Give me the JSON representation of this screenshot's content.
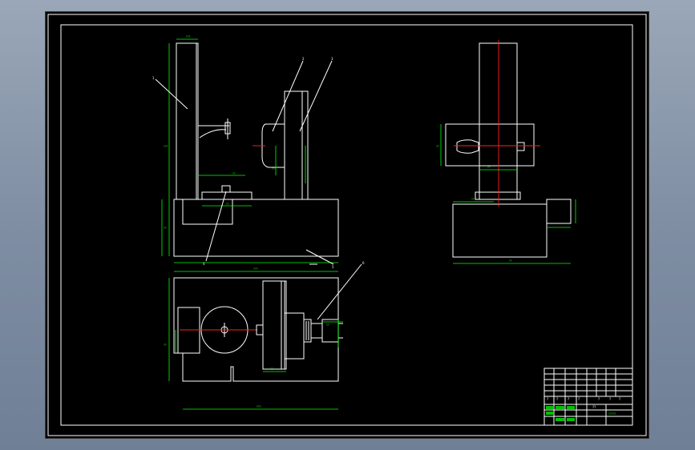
{
  "drawing": {
    "background_color": "#000000",
    "geometry_color": "#ffffff",
    "dimension_color": "#00ff00",
    "centerline_color": "#ff2020"
  },
  "part_callouts": [
    "1",
    "2",
    "3",
    "4",
    "5",
    "6"
  ],
  "title_block": {
    "label_a": "??",
    "label_b": "?????"
  }
}
